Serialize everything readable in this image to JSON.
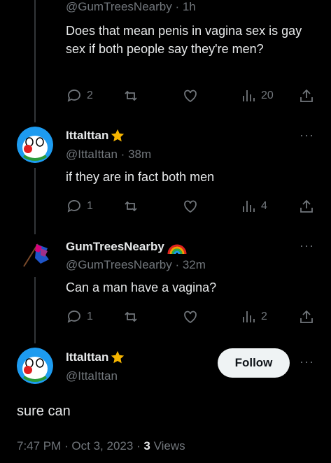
{
  "tweets": [
    {
      "handle_line": "@GumTreesNearby · 1h",
      "text": "Does that mean penis in vagina sex is gay sex if both people say they're men?",
      "replies": "2",
      "views": "20"
    },
    {
      "name": "IttaIttan",
      "handle_line": "@IttaIttan · 38m",
      "text": "if they are in fact both men",
      "replies": "1",
      "views": "4"
    },
    {
      "name": "GumTreesNearby",
      "handle_line": "@GumTreesNearby · 32m",
      "text": "Can a man have a vagina?",
      "replies": "1",
      "views": "2"
    }
  ],
  "main_tweet": {
    "name": "IttaIttan",
    "handle": "@IttaIttan",
    "follow_label": "Follow",
    "text": "sure can",
    "timestamp": "7:47 PM · Oct 3, 2023 · ",
    "views_count": "3",
    "views_label": " Views"
  },
  "more_label": "···",
  "colors": {
    "background": "#000000",
    "text": "#e7e9ea",
    "muted": "#71767b",
    "star": "#f5b400"
  }
}
